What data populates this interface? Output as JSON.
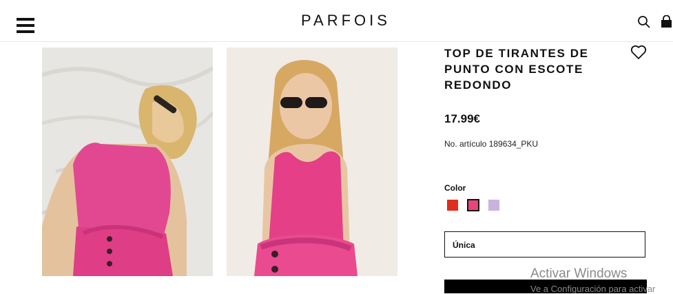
{
  "header": {
    "brand": "PARFOIS",
    "menu_icon": "hamburger-menu-icon",
    "search_icon": "search-icon",
    "bag_icon": "shopping-bag-icon"
  },
  "product": {
    "title": "TOP DE TIRANTES DE PUNTO CON ESCOTE REDONDO",
    "price": "17.99€",
    "article": "No. artículo 189634_PKU",
    "wishlist_icon": "heart-icon",
    "color_label": "Color",
    "colors": [
      "#dd2e1e",
      "#e8457a",
      "#c9b3df"
    ],
    "selected_color": "#e8457a",
    "size": "Única",
    "images": [
      "product-photo-model-tilted-head",
      "product-photo-model-front"
    ]
  },
  "watermark": {
    "line1": "Activar Windows",
    "line2": "Ve a Configuración para activar"
  }
}
